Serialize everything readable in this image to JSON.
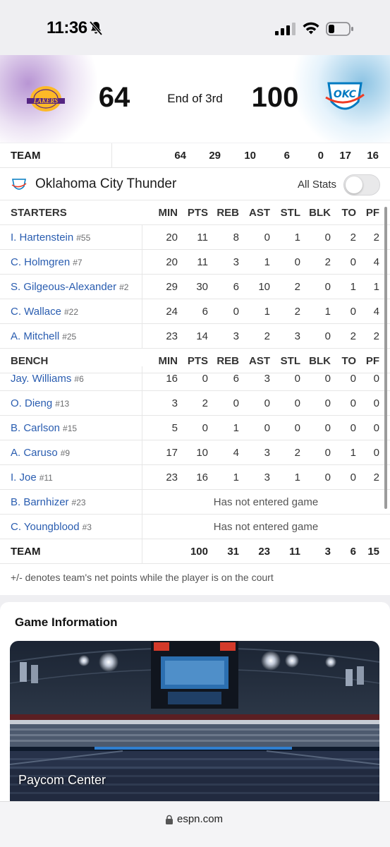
{
  "status_bar": {
    "time": "11:36"
  },
  "scoreboard": {
    "away_score": "64",
    "home_score": "100",
    "status": "End of 3rd"
  },
  "away_team_total": {
    "label": "TEAM",
    "values": [
      "64",
      "29",
      "10",
      "6",
      "0",
      "17",
      "16"
    ]
  },
  "team": {
    "name": "Oklahoma City Thunder",
    "all_stats_label": "All Stats"
  },
  "columns": [
    "MIN",
    "PTS",
    "REB",
    "AST",
    "STL",
    "BLK",
    "TO",
    "PF"
  ],
  "starters": {
    "label": "STARTERS",
    "players": [
      {
        "name": "I. Hartenstein",
        "jersey": "#55",
        "stats": [
          "20",
          "11",
          "8",
          "0",
          "1",
          "0",
          "2",
          "2"
        ]
      },
      {
        "name": "C. Holmgren",
        "jersey": "#7",
        "stats": [
          "20",
          "11",
          "3",
          "1",
          "0",
          "2",
          "0",
          "4"
        ]
      },
      {
        "name": "S. Gilgeous-Alexander",
        "jersey": "#2",
        "stats": [
          "29",
          "30",
          "6",
          "10",
          "2",
          "0",
          "1",
          "1"
        ]
      },
      {
        "name": "C. Wallace",
        "jersey": "#22",
        "stats": [
          "24",
          "6",
          "0",
          "1",
          "2",
          "1",
          "0",
          "4"
        ]
      },
      {
        "name": "A. Mitchell",
        "jersey": "#25",
        "stats": [
          "23",
          "14",
          "3",
          "2",
          "3",
          "0",
          "2",
          "2"
        ]
      }
    ]
  },
  "bench": {
    "label": "BENCH",
    "players": [
      {
        "name": "Jay. Williams",
        "jersey": "#6",
        "stats": [
          "16",
          "0",
          "6",
          "3",
          "0",
          "0",
          "0",
          "0"
        ]
      },
      {
        "name": "O. Dieng",
        "jersey": "#13",
        "stats": [
          "3",
          "2",
          "0",
          "0",
          "0",
          "0",
          "0",
          "0"
        ]
      },
      {
        "name": "B. Carlson",
        "jersey": "#15",
        "stats": [
          "5",
          "0",
          "1",
          "0",
          "0",
          "0",
          "0",
          "0"
        ]
      },
      {
        "name": "A. Caruso",
        "jersey": "#9",
        "stats": [
          "17",
          "10",
          "4",
          "3",
          "2",
          "0",
          "1",
          "0"
        ]
      },
      {
        "name": "I. Joe",
        "jersey": "#11",
        "stats": [
          "23",
          "16",
          "1",
          "3",
          "1",
          "0",
          "0",
          "2"
        ]
      }
    ],
    "dnp": [
      {
        "name": "B. Barnhizer",
        "jersey": "#23",
        "note": "Has not entered game"
      },
      {
        "name": "C. Youngblood",
        "jersey": "#3",
        "note": "Has not entered game"
      }
    ]
  },
  "team_total": {
    "label": "TEAM",
    "values": [
      "100",
      "31",
      "23",
      "11",
      "3",
      "6",
      "15"
    ]
  },
  "footnote": "+/- denotes team's net points while the player is on the court",
  "game_info": {
    "title": "Game Information",
    "venue": "Paycom Center"
  },
  "url_bar": {
    "domain": "espn.com"
  },
  "colors": {
    "link_blue": "#2a5db0",
    "lakers_purple": "#552583",
    "lakers_gold": "#fdb927",
    "thunder_blue": "#007ac1",
    "thunder_orange": "#ef3b24"
  }
}
